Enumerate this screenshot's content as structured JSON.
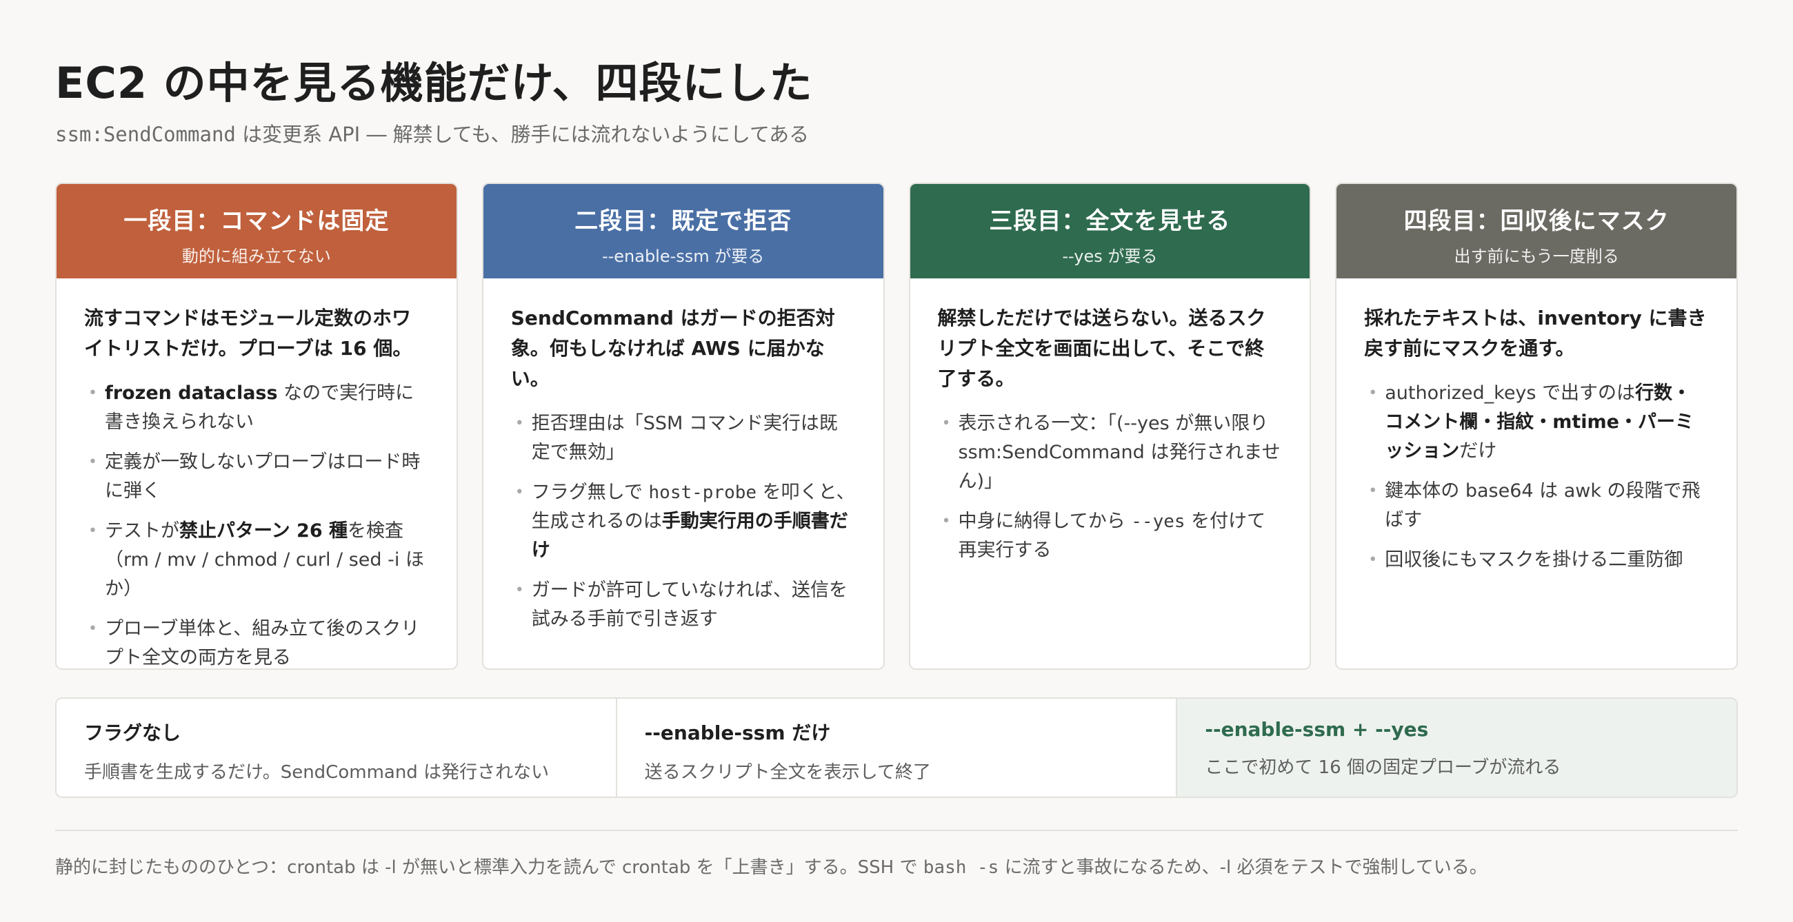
{
  "title": "EC2 の中を見る機能だけ、四段にした",
  "subtitle": {
    "code": "ssm:SendCommand",
    "text": " は変更系 API ― 解禁しても、勝手には流れないようにしてある"
  },
  "cards": [
    {
      "heading": "一段目：コマンドは固定",
      "sub": "動的に組み立てない",
      "lead": "流すコマンドはモジュール定数のホワイトリストだけ。プローブは 16 個。",
      "items": [
        {
          "b": "frozen dataclass",
          "t": " なので実行時に書き換えられない"
        },
        {
          "t": "定義が一致しないプローブはロード時に弾く"
        },
        {
          "t1": "テストが",
          "b": "禁止パターン 26 種",
          "t2": "を検査（rm / mv / chmod / curl / sed -i ほか）"
        },
        {
          "t": "プローブ単体と、組み立て後のスクリプト全文の両方を見る"
        }
      ]
    },
    {
      "heading": "二段目：既定で拒否",
      "sub": "--enable-ssm が要る",
      "lead": "SendCommand はガードの拒否対象。何もしなければ AWS に届かない。",
      "items": [
        {
          "t": "拒否理由は「SSM コマンド実行は既定で無効」"
        },
        {
          "t1": "フラグ無しで ",
          "code": "host-probe",
          "t2": " を叩くと、生成されるのは",
          "b": "手動実行用の手順書だけ"
        },
        {
          "t": "ガードが許可していなければ、送信を試みる手前で引き返す"
        }
      ]
    },
    {
      "heading": "三段目：全文を見せる",
      "sub": "--yes が要る",
      "lead": "解禁しただけでは送らない。送るスクリプト全文を画面に出して、そこで終了する。",
      "items": [
        {
          "t": "表示される一文：「(--yes が無い限り ssm:SendCommand は発行されません)」"
        },
        {
          "t1": "中身に納得してから ",
          "code": "--yes",
          "t2": " を付けて再実行する"
        }
      ]
    },
    {
      "heading": "四段目：回収後にマスク",
      "sub": "出す前にもう一度削る",
      "lead": "採れたテキストは、inventory に書き戻す前にマスクを通す。",
      "items": [
        {
          "t1": "authorized_keys で出すのは",
          "b": "行数・コメント欄・指紋・mtime・パーミッション",
          "t2": "だけ"
        },
        {
          "t": "鍵本体の base64 は awk の段階で飛ばす"
        },
        {
          "t": "回収後にもマスクを掛ける二重防御"
        }
      ]
    }
  ],
  "flags": [
    {
      "title": "フラグなし",
      "desc": "手順書を生成するだけ。SendCommand は発行されない"
    },
    {
      "title": "--enable-ssm だけ",
      "desc": "送るスクリプト全文を表示して終了"
    },
    {
      "title": "--enable-ssm + --yes",
      "desc": "ここで初めて 16 個の固定プローブが流れる"
    }
  ],
  "footnote": {
    "t1": "静的に封じたもののひとつ：crontab は -l が無いと標準入力を読んで crontab を「上書き」する。SSH で ",
    "code": "bash -s",
    "t2": " に流すと事故になるため、-l 必須をテストで強制している。"
  }
}
